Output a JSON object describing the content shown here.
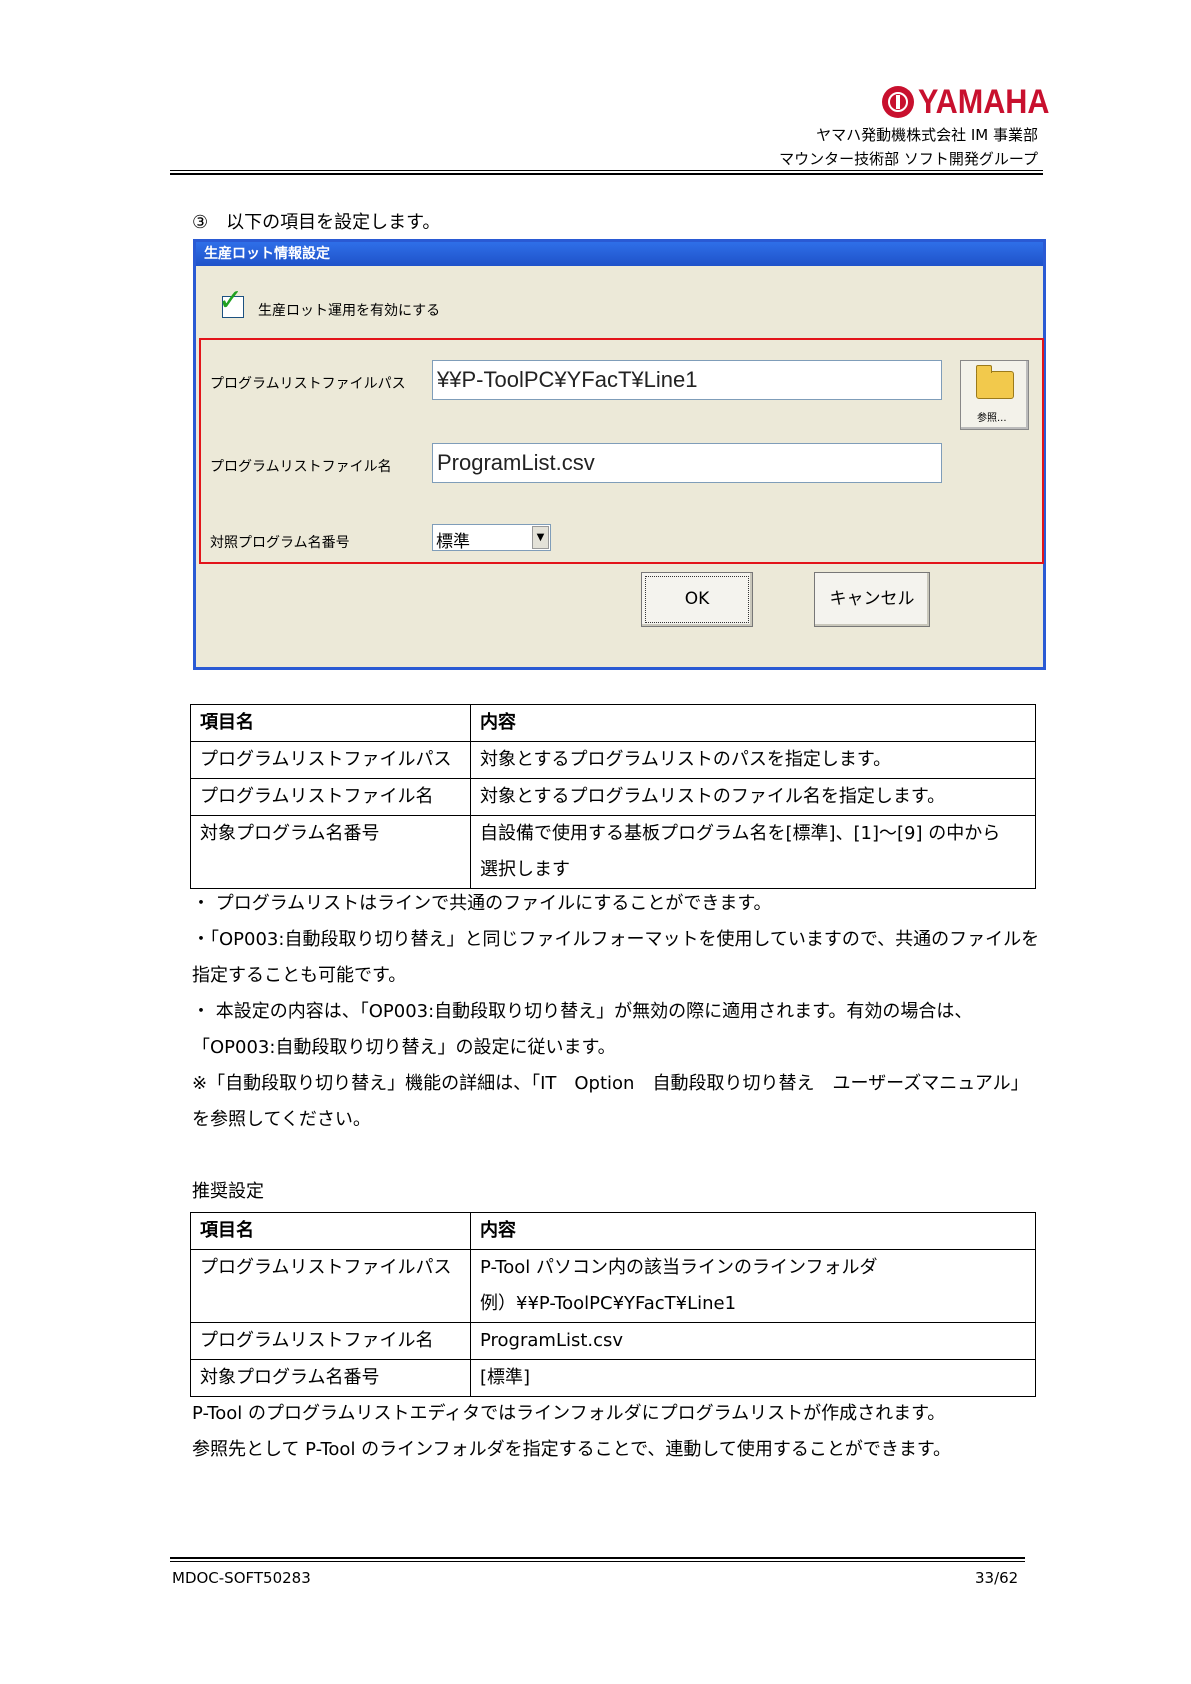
{
  "header": {
    "brand": "YAMAHA",
    "company": "ヤマハ発動機株式会社 IM 事業部",
    "department": "マウンター技術部 ソフト開発グループ"
  },
  "step": "③　以下の項目を設定します。",
  "dialog": {
    "title": "生産ロット情報設定",
    "enable_checkbox_label": "生産ロット運用を有効にする",
    "enable_checked": true,
    "path_label": "プログラムリストファイルパス",
    "path_value": "¥¥P-ToolPC¥YFacT¥Line1",
    "browse_label": "参照...",
    "filename_label": "プログラムリストファイル名",
    "filename_value": "ProgramList.csv",
    "number_label": "対照プログラム名番号",
    "number_value": "標準",
    "ok_label": "OK",
    "cancel_label": "キャンセル"
  },
  "table1": {
    "headers": [
      "項目名",
      "内容"
    ],
    "rows": [
      [
        "プログラムリストファイルパス",
        "対象とするプログラムリストのパスを指定します。"
      ],
      [
        "プログラムリストファイル名",
        "対象とするプログラムリストのファイル名を指定します。"
      ],
      [
        "対象プログラム名番号",
        "自設備で使用する基板プログラム名を[標準]、[1]～[9] の中から"
      ]
    ],
    "row3_cont": "選択します"
  },
  "notes": [
    "・ プログラムリストはラインで共通のファイルにすることができます。",
    "・「OP003:自動段取り切り替え」と同じファイルフォーマットを使用していますので、共通のファイルを",
    "指定することも可能です。",
    "・ 本設定の内容は、「OP003:自動段取り切り替え」が無効の際に適用されます。有効の場合は、",
    "「OP003:自動段取り切り替え」の設定に従います。",
    "※「自動段取り切り替え」機能の詳細は、「IT　Option　自動段取り切り替え　ユーザーズマニュアル」",
    "を参照してください。"
  ],
  "recommended_title": "推奨設定",
  "table2": {
    "headers": [
      "項目名",
      "内容"
    ],
    "rows": [
      [
        "プログラムリストファイルパス",
        "P-Tool パソコン内の該当ラインのラインフォルダ"
      ],
      [
        "プログラムリストファイル名",
        "ProgramList.csv"
      ],
      [
        "対象プログラム名番号",
        "[標準]"
      ]
    ],
    "row1_cont": "例）¥¥P-ToolPC¥YFacT¥Line1"
  },
  "footnotes": [
    "P-Tool のプログラムリストエディタではラインフォルダにプログラムリストが作成されます。",
    "参照先として P-Tool のラインフォルダを指定することで、連動して使用することができます。"
  ],
  "footer": {
    "doc_id": "MDOC-SOFT50283",
    "page": "33/62"
  }
}
